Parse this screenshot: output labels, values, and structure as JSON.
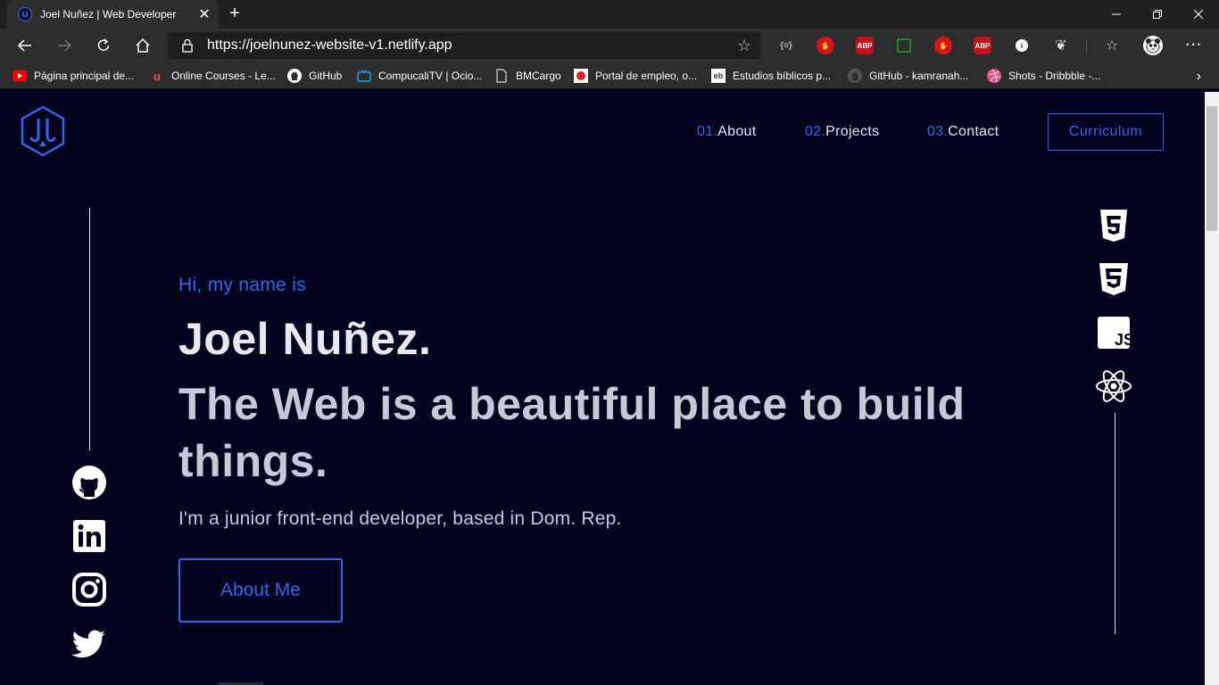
{
  "browser": {
    "tab_title": "Joel Nuñez | Web Developer",
    "url_host": "https://joelnunez-website-v1.netlify.app",
    "extensions": [
      "code-icon",
      "stop-icon",
      "abp-icon",
      "screenshot-icon",
      "stop-icon",
      "abp-icon",
      "circle-icon",
      "gnome-icon",
      "favorites-icon",
      "profile-icon",
      "menu-icon"
    ],
    "bookmarks": [
      {
        "label": "Página principal de...",
        "icon": "youtube-icon",
        "color": "#ff0000"
      },
      {
        "label": "Online Courses - Le...",
        "icon": "udemy-icon",
        "color": "#ec5252"
      },
      {
        "label": "GitHub",
        "icon": "github-icon",
        "color": "#ffffff"
      },
      {
        "label": "CompucaliTV | Ocio...",
        "icon": "tv-icon",
        "color": "#2a9df4"
      },
      {
        "label": "BMCargo",
        "icon": "page-icon",
        "color": "#ffffff"
      },
      {
        "label": "Portal de empleo, o...",
        "icon": "job-icon",
        "color": "#e02020"
      },
      {
        "label": "Estudios bíblicos p...",
        "icon": "eb-icon",
        "color": "#f0a020"
      },
      {
        "label": "GitHub - kamranah...",
        "icon": "github-icon",
        "color": "#999999"
      },
      {
        "label": "Shots - Dribbble -...",
        "icon": "dribbble-icon",
        "color": "#ea4c89"
      }
    ]
  },
  "nav": {
    "items": [
      {
        "num": "01.",
        "label": "About"
      },
      {
        "num": "02.",
        "label": "Projects"
      },
      {
        "num": "03.",
        "label": "Contact"
      }
    ],
    "cv_label": "Curriculum"
  },
  "hero": {
    "greeting": "Hi, my name is",
    "name": "Joel Nuñez.",
    "tagline": "The Web is a beautiful place to build things.",
    "description": "I'm a junior front-end developer, based in Dom. Rep.",
    "button": "About Me"
  },
  "social": [
    "github-icon",
    "linkedin-icon",
    "instagram-icon",
    "twitter-icon"
  ],
  "tech": [
    "html5-icon",
    "css3-icon",
    "javascript-icon",
    "react-icon"
  ],
  "colors": {
    "background": "#050420",
    "accent": "#2f68e8",
    "text": "#e8e8f0",
    "muted": "#c8c8d8"
  }
}
